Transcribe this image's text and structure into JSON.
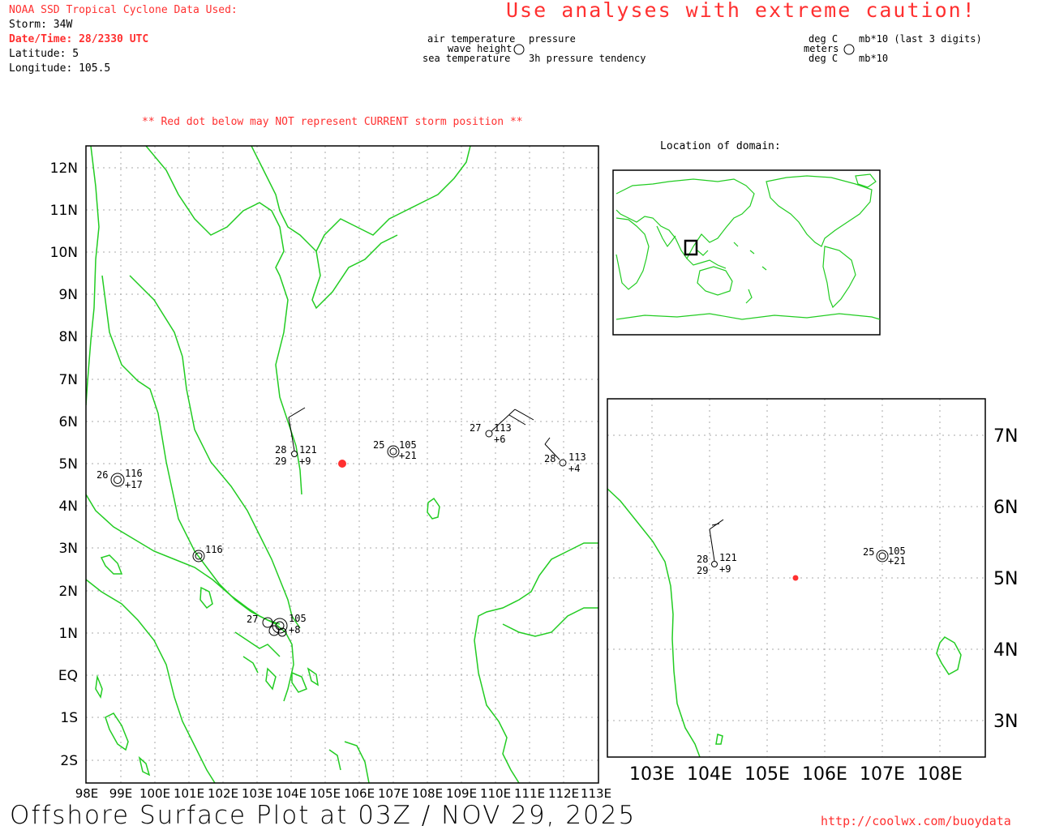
{
  "header": {
    "source": "NOAA SSD Tropical Cyclone Data Used:",
    "storm": "Storm: 34W",
    "datetime": "Date/Time: 28/2330 UTC",
    "latitude": "Latitude: 5",
    "longitude": "Longitude: 105.5"
  },
  "caution": "Use analyses with extreme caution!",
  "legend_left": {
    "air_temp": "air temperature",
    "wave_height": "wave height",
    "sea_temp": "sea temperature",
    "pressure": "pressure",
    "tendency": "3h pressure tendency"
  },
  "legend_right": {
    "deg_c_top": "deg C",
    "meters": "meters",
    "deg_c_bottom": "deg C",
    "mb_top": "mb*10 (last 3 digits)",
    "mb_bottom": "mb*10"
  },
  "red_dot_note": "** Red dot below may NOT represent CURRENT storm position **",
  "inset_title": "Location of domain:",
  "main_map": {
    "lat_labels": [
      "12N",
      "11N",
      "10N",
      "9N",
      "8N",
      "7N",
      "6N",
      "5N",
      "4N",
      "3N",
      "2N",
      "1N",
      "EQ",
      "1S",
      "2S"
    ],
    "lon_labels": [
      "98E",
      "99E",
      "100E",
      "101E",
      "102E",
      "103E",
      "104E",
      "105E",
      "106E",
      "107E",
      "108E",
      "109E",
      "110E",
      "111E",
      "112E",
      "113E"
    ],
    "storm_position": {
      "lon": 105.5,
      "lat": 5.0
    },
    "observations": [
      {
        "air": "28",
        "sea": "29",
        "pressure": "121",
        "tendency": "+9"
      },
      {
        "air": "25",
        "pressure": "105",
        "tendency": "+21"
      },
      {
        "air": "27",
        "pressure": "113",
        "tendency": "+6"
      },
      {
        "air": "28",
        "pressure": "113",
        "tendency": "+4"
      },
      {
        "air": "26",
        "pressure": "116",
        "tendency": "+17"
      },
      {
        "pressure": "116"
      },
      {
        "air": "27",
        "pressure": "105",
        "tendency": "+8"
      }
    ]
  },
  "zoom_map": {
    "lat_labels": [
      "7N",
      "6N",
      "5N",
      "4N",
      "3N"
    ],
    "lon_labels": [
      "103E",
      "104E",
      "105E",
      "106E",
      "107E",
      "108E"
    ],
    "observations": [
      {
        "air": "28",
        "sea": "29",
        "pressure": "121",
        "tendency": "+9"
      },
      {
        "air": "25",
        "pressure": "105",
        "tendency": "+21"
      }
    ]
  },
  "footer": {
    "title": "Offshore Surface Plot at 03Z / NOV 29, 2025",
    "url": "http://coolwx.com/buoydata"
  },
  "colors": {
    "coast": "#22cc22",
    "accent": "#ff3030",
    "grid": "#999999"
  }
}
